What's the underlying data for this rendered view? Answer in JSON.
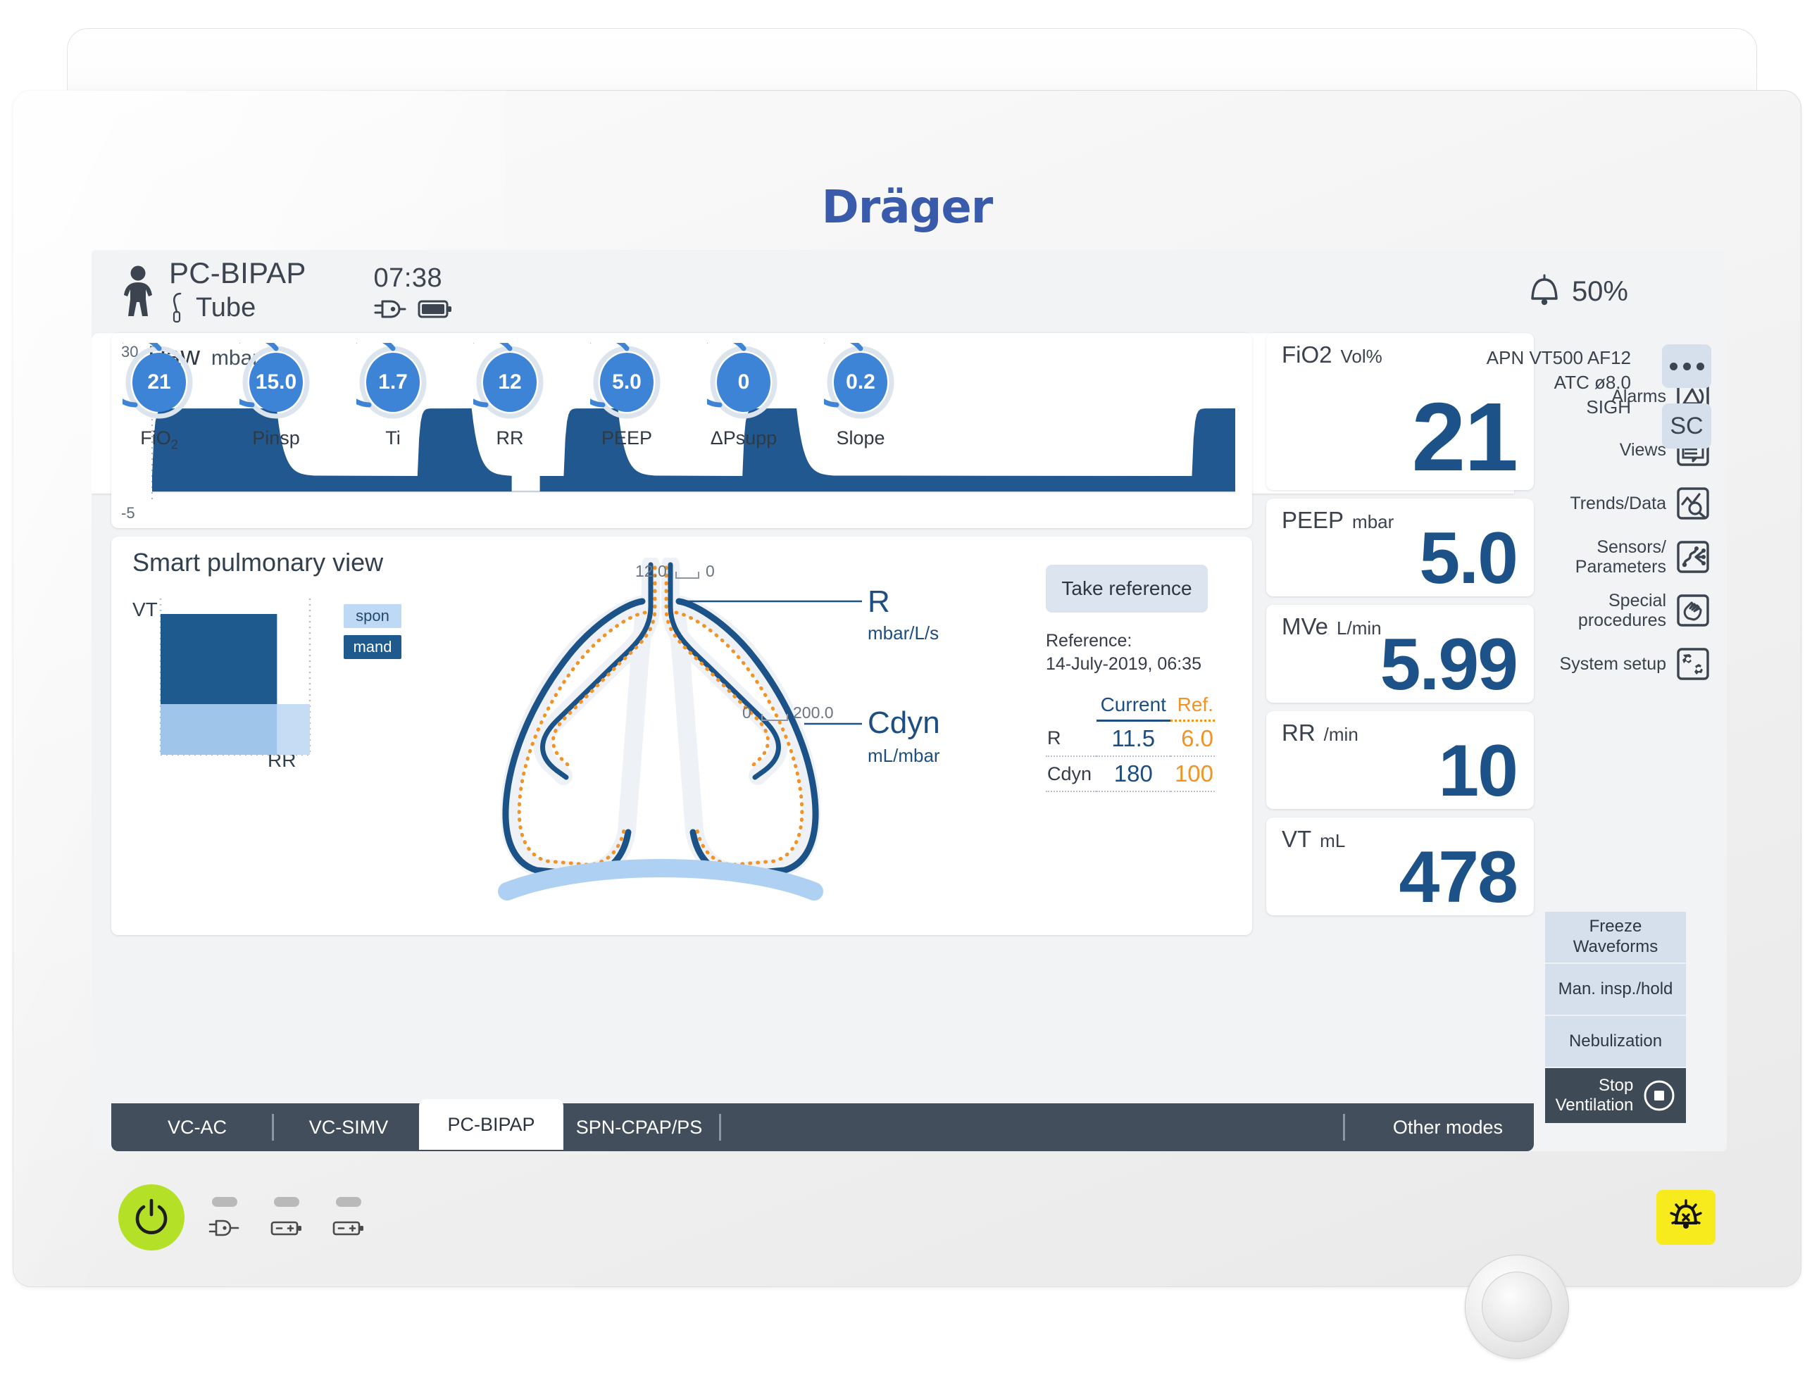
{
  "device": {
    "brand": "Dräger"
  },
  "header": {
    "patient_icon": "adult-patient-icon",
    "mode": "PC-BIPAP",
    "airway": "Tube",
    "clock": "07:38",
    "mains_icon": "mains-plug-icon",
    "battery_icon": "battery-icon",
    "alarm_volume": "50%",
    "bell_icon": "bell-icon"
  },
  "waveform": {
    "title": "Paw",
    "unit": "mbar",
    "axis_top": "30",
    "axis_bottom": "-5"
  },
  "chart_data": {
    "type": "area",
    "title": "Paw",
    "ylabel": "mbar",
    "xlabel": "",
    "ylim": [
      -5,
      30
    ],
    "grid": false,
    "legend": "none",
    "series": [
      {
        "name": "Paw",
        "description": "Airway pressure square-wave, PC-BIPAP; plateau 15.0 mbar, baseline PEEP 5.0 mbar",
        "baseline": 5.0,
        "plateau": 15.0,
        "breaths": [
          {
            "start": 0.0,
            "insp_end": 0.115,
            "exp_end": 0.245
          },
          {
            "start": 0.245,
            "insp_end": 0.295,
            "exp_end": 0.33
          },
          {
            "start": 0.38,
            "insp_end": 0.43,
            "exp_end": 0.545
          },
          {
            "start": 0.545,
            "insp_end": 0.595,
            "exp_end": 0.71
          },
          {
            "start": 0.96,
            "insp_end": 1.0,
            "exp_end": 1.0
          }
        ],
        "sweep_gap": [
          0.332,
          0.358
        ]
      }
    ]
  },
  "spv": {
    "title": "Smart pulmonary view",
    "vt_axis_label": "VT",
    "rr_axis_label": "RR",
    "legend": [
      {
        "key": "spon",
        "label": "spon",
        "color": "#bed9f3"
      },
      {
        "key": "mand",
        "label": "mand",
        "color": "#1f5a8f"
      }
    ],
    "vt_rr_chart": {
      "type": "bar",
      "description": "Stacked VT vs RR block: mandatory portion dark blue, spontaneous portion light blue",
      "mand_vt_fraction": 0.64,
      "spon_vt_fraction": 0.36,
      "mand_rr_fraction": 0.78,
      "spon_rr_fraction": 0.22
    },
    "r_label": "R",
    "r_unit": "mbar/L/s",
    "cdyn_label": "Cdyn",
    "cdyn_unit": "mL/mbar",
    "r_scale_left": "12.0",
    "r_scale_right": "0",
    "cdyn_scale_left": "0",
    "cdyn_scale_right": "200.0",
    "take_reference": "Take reference",
    "reference_caption": "Reference:",
    "reference_timestamp": "14-July-2019, 06:35",
    "table": {
      "headers": [
        "",
        "Current",
        "Ref."
      ],
      "rows": [
        {
          "name": "R",
          "current": "11.5",
          "ref": "6.0"
        },
        {
          "name": "Cdyn",
          "current": "180",
          "ref": "100"
        }
      ]
    }
  },
  "measured": [
    {
      "id": "fio2",
      "label": "FiO2",
      "unit": "Vol%",
      "value": "21"
    },
    {
      "id": "peep",
      "label": "PEEP",
      "unit": "mbar",
      "value": "5.0"
    },
    {
      "id": "mve",
      "label": "MVe",
      "unit": "L/min",
      "value": "5.99"
    },
    {
      "id": "rr",
      "label": "RR",
      "unit": "/min",
      "value": "10"
    },
    {
      "id": "vt",
      "label": "VT",
      "unit": "mL",
      "value": "478"
    }
  ],
  "menu": [
    {
      "label": "Alarms",
      "icon": "alarms-icon"
    },
    {
      "label": "Views",
      "icon": "views-icon"
    },
    {
      "label": "Trends/Data",
      "icon": "trends-data-icon"
    },
    {
      "label": "Sensors/\nParameters",
      "icon": "sensors-parameters-icon"
    },
    {
      "label": "Special\nprocedures",
      "icon": "special-procedures-icon"
    },
    {
      "label": "System setup",
      "icon": "system-setup-icon"
    }
  ],
  "side_actions": [
    {
      "label": "Freeze\nWaveforms"
    },
    {
      "label": "Man. insp./hold"
    },
    {
      "label": "Nebulization"
    }
  ],
  "stop_ventilation": {
    "label": "Stop\nVentilation",
    "icon": "stop-square-icon"
  },
  "settings": {
    "dials": [
      {
        "name": "FiO",
        "sub": "2",
        "value": "21",
        "arc": 0.62
      },
      {
        "name": "Pinsp",
        "sub": "",
        "value": "15.0",
        "arc": 0.62
      },
      {
        "name": "Ti",
        "sub": "",
        "value": "1.7",
        "arc": 0.62
      },
      {
        "name": "RR",
        "sub": "",
        "value": "12",
        "arc": 0.62
      },
      {
        "name": "PEEP",
        "sub": "",
        "value": "5.0",
        "arc": 0.62
      },
      {
        "name": "ΔPsupp",
        "sub": "",
        "value": "0",
        "arc": 0.62
      },
      {
        "name": "Slope",
        "sub": "",
        "value": "0.2",
        "arc": 0.62
      }
    ],
    "status_lines": [
      "APN  VT500  AF12",
      "ATC  ø8.0",
      "SIGH"
    ],
    "more_button": "more-options-icon",
    "sc_button": "SC"
  },
  "tabs": [
    {
      "label": "VC-AC",
      "active": false
    },
    {
      "label": "VC-SIMV",
      "active": false
    },
    {
      "label": "PC-BIPAP",
      "active": true
    },
    {
      "label": "SPN-CPAP/PS",
      "active": false
    }
  ],
  "other_modes": "Other modes",
  "hardware": {
    "power_icon": "power-icon",
    "mains_led_icon": "mains-plug-icon",
    "battery1_icon": "battery-icon",
    "battery2_icon": "battery-icon",
    "alarm_mute_icon": "alarm-silence-icon"
  },
  "colors": {
    "accent_blue": "#1d5288",
    "dial_blue": "#3d83d6",
    "orange": "#f29325",
    "dark_ui": "#434e5c",
    "panel_blue": "#d6e0ec",
    "power_green": "#b5e028",
    "alarm_yellow": "#f7ea1d"
  }
}
